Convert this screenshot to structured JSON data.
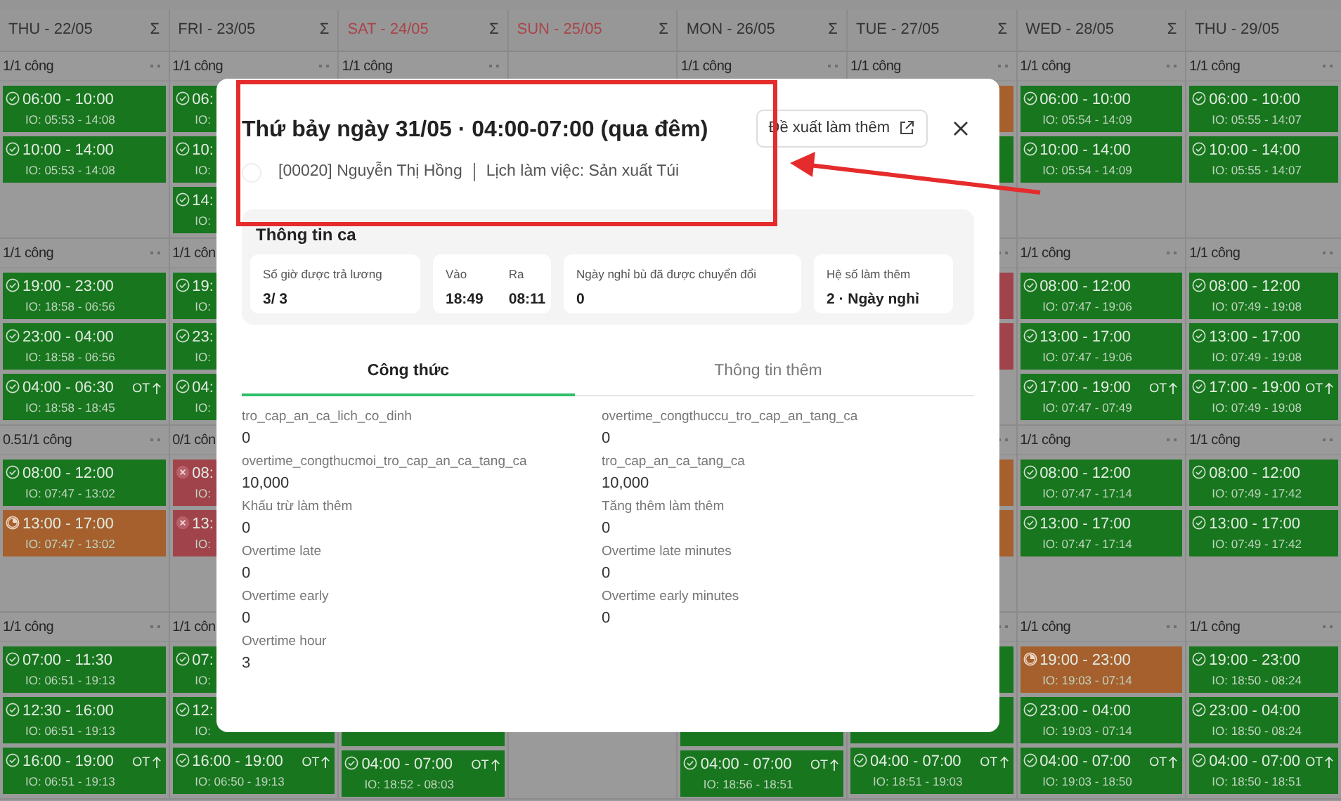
{
  "calendar": {
    "columns": [
      {
        "day": "THU - 22/05",
        "sigma": "Σ",
        "weekend": false,
        "weeks": [
          {
            "summary": {
              "text": "1/1 công",
              "dots": true
            },
            "shifts": [
              {
                "kind": "ok",
                "time": "06:00 - 10:00",
                "io": "IO: 05:53 - 14:08"
              },
              {
                "kind": "ok",
                "time": "10:00 - 14:00",
                "io": "IO: 05:53 - 14:08"
              }
            ]
          },
          {
            "summary": {
              "text": "1/1 công",
              "dots": true
            },
            "shifts": [
              {
                "kind": "ok",
                "time": "19:00 - 23:00",
                "io": "IO: 18:58 - 06:56"
              },
              {
                "kind": "ok",
                "time": "23:00 - 04:00",
                "io": "IO: 18:58 - 06:56"
              },
              {
                "kind": "ok",
                "time": "04:00 - 06:30",
                "ot": "OT",
                "io": "IO: 18:58 - 18:45"
              }
            ]
          },
          {
            "summary": {
              "text": "0.51/1 công",
              "dots": true
            },
            "shifts": [
              {
                "kind": "ok",
                "time": "08:00 - 12:00",
                "io": "IO: 07:47 - 13:02"
              },
              {
                "kind": "partial",
                "time": "13:00 - 17:00",
                "io": "IO: 07:47 - 13:02"
              }
            ]
          },
          {
            "summary": {
              "text": "1/1 công",
              "dots": true
            },
            "shifts": [
              {
                "kind": "ok",
                "time": "07:00 - 11:30",
                "io": "IO: 06:51 - 19:13"
              },
              {
                "kind": "ok",
                "time": "12:30 - 16:00",
                "io": "IO: 06:51 - 19:13"
              },
              {
                "kind": "ok",
                "time": "16:00 - 19:00",
                "ot": "OT",
                "io": "IO: 06:51 - 19:13"
              }
            ]
          }
        ]
      },
      {
        "day": "FRI - 23/05",
        "sigma": "Σ",
        "weekend": false,
        "weeks": [
          {
            "summary": {
              "text": "1/1 công",
              "dots": true
            },
            "shifts": [
              {
                "kind": "ok",
                "time": "06:",
                "io": "IO:"
              },
              {
                "kind": "ok",
                "time": "10:",
                "io": "IO:"
              },
              {
                "kind": "ok",
                "time": "14:",
                "io": "IO:"
              }
            ]
          },
          {
            "summary": {
              "text": "1/1 côn",
              "dots": false
            },
            "shifts": [
              {
                "kind": "ok",
                "time": "19:",
                "io": "IO:"
              },
              {
                "kind": "ok",
                "time": "23:",
                "io": "IO:"
              },
              {
                "kind": "ok",
                "time": "04:",
                "io": "IO:"
              }
            ]
          },
          {
            "summary": {
              "text": "0/1 côn",
              "dots": false
            },
            "shifts": [
              {
                "kind": "absent",
                "time": "08:",
                "io": "IO:"
              },
              {
                "kind": "absent",
                "time": "13:",
                "io": "IO:"
              }
            ]
          },
          {
            "summary": {
              "text": "1/1 côn",
              "dots": false
            },
            "shifts": [
              {
                "kind": "ok",
                "time": "07:",
                "io": "IO:"
              },
              {
                "kind": "ok",
                "time": "12:",
                "io": "IO:"
              },
              {
                "kind": "ok",
                "time": "16:00 - 19:00",
                "ot": "OT",
                "io": "IO: 06:50 - 19:13"
              }
            ]
          }
        ]
      },
      {
        "day": "SAT - 24/05",
        "sigma": "Σ",
        "weekend": true,
        "weeks": [
          {
            "summary": {
              "text": "1/1 công",
              "dots": true
            }
          }
        ],
        "last_week": {
          "shifts": [
            {
              "kind": "ok"
            },
            {
              "kind": "ok",
              "time": "04:00 - 07:00",
              "ot": "OT",
              "io": "IO: 18:52 - 08:03"
            }
          ]
        }
      },
      {
        "day": "SUN - 25/05",
        "sigma": "Σ",
        "weekend": true
      },
      {
        "day": "MON - 26/05",
        "sigma": "Σ",
        "weekend": false,
        "weeks": [
          {
            "summary": {
              "text": "1/1 công",
              "dots": true
            }
          }
        ],
        "last_week": {
          "shifts": [
            {
              "kind": "ok"
            },
            {
              "kind": "ok",
              "time": "04:00 - 07:00",
              "ot": "OT",
              "io": "IO: 18:56 - 18:51"
            }
          ]
        }
      },
      {
        "day": "TUE - 27/05",
        "sigma": "Σ",
        "weekend": false,
        "weeks": [
          {
            "summary": {
              "text": "1/1 công",
              "dots": true
            },
            "shifts": [
              {
                "kind": "partial"
              },
              {
                "kind": "ok"
              }
            ]
          },
          {
            "summary": {
              "dots": true
            },
            "shifts": [
              {
                "kind": "absent"
              },
              {
                "kind": "absent"
              }
            ]
          },
          {
            "summary": {
              "dots": true
            },
            "shifts": [
              {
                "kind": "partial"
              },
              {
                "kind": "partial"
              }
            ]
          },
          {
            "summary": {
              "dots": true
            },
            "shifts": [
              {
                "kind": "ok"
              },
              {
                "kind": "ok"
              },
              {
                "kind": "ok",
                "time": "04:00 - 07:00",
                "ot": "OT",
                "io": "IO: 18:51 - 19:03"
              }
            ]
          }
        ]
      },
      {
        "day": "WED - 28/05",
        "sigma": "Σ",
        "weekend": false,
        "weeks": [
          {
            "summary": {
              "text": "1/1 công",
              "dots": true
            },
            "shifts": [
              {
                "kind": "ok",
                "time": "06:00 - 10:00",
                "io": "IO: 05:54 - 14:09"
              },
              {
                "kind": "ok",
                "time": "10:00 - 14:00",
                "io": "IO: 05:54 - 14:09"
              }
            ]
          },
          {
            "summary": {
              "text": "1/1 công",
              "dots": true
            },
            "shifts": [
              {
                "kind": "ok",
                "time": "08:00 - 12:00",
                "io": "IO: 07:47 - 19:06"
              },
              {
                "kind": "ok",
                "time": "13:00 - 17:00",
                "io": "IO: 07:47 - 19:06"
              },
              {
                "kind": "ok",
                "time": "17:00 - 19:00",
                "ot": "OT",
                "io": "IO: 07:47 - 07:49"
              }
            ]
          },
          {
            "summary": {
              "text": "1/1 công",
              "dots": true
            },
            "shifts": [
              {
                "kind": "ok",
                "time": "08:00 - 12:00",
                "io": "IO: 07:47 - 17:14"
              },
              {
                "kind": "ok",
                "time": "13:00 - 17:00",
                "io": "IO: 07:47 - 17:14"
              }
            ]
          },
          {
            "summary": {
              "text": "1/1 công",
              "dots": true
            },
            "shifts": [
              {
                "kind": "partial",
                "time": "19:00 - 23:00",
                "io": "IO: 19:03 - 07:14"
              },
              {
                "kind": "ok",
                "time": "23:00 - 04:00",
                "io": "IO: 19:03 - 07:14"
              },
              {
                "kind": "ok",
                "time": "04:00 - 07:00",
                "ot": "OT",
                "io": "IO: 19:03 - 18:50"
              }
            ]
          }
        ]
      },
      {
        "day": "THU - 29/05",
        "weekend": false,
        "weeks": [
          {
            "summary": {
              "text": "1/1 công",
              "dots": true
            },
            "shifts": [
              {
                "kind": "ok",
                "time": "06:00 - 10:00",
                "io": "IO: 05:55 - 14:07"
              },
              {
                "kind": "ok",
                "time": "10:00 - 14:00",
                "io": "IO: 05:55 - 14:07"
              }
            ]
          },
          {
            "summary": {
              "text": "1/1 công",
              "dots": true
            },
            "shifts": [
              {
                "kind": "ok",
                "time": "08:00 - 12:00",
                "io": "IO: 07:49 - 19:08"
              },
              {
                "kind": "ok",
                "time": "13:00 - 17:00",
                "io": "IO: 07:49 - 19:08"
              },
              {
                "kind": "ok",
                "time": "17:00 - 19:00",
                "ot": "OT",
                "io": "IO: 07:49 - 19:08"
              }
            ]
          },
          {
            "summary": {
              "text": "1/1 công",
              "dots": true
            },
            "shifts": [
              {
                "kind": "ok",
                "time": "08:00 - 12:00",
                "io": "IO: 07:49 - 17:42"
              },
              {
                "kind": "ok",
                "time": "13:00 - 17:00",
                "io": "IO: 07:49 - 17:42"
              }
            ]
          },
          {
            "summary": {
              "text": "1/1 công",
              "dots": true
            },
            "shifts": [
              {
                "kind": "ok",
                "time": "19:00 - 23:00",
                "io": "IO: 18:50 - 08:24"
              },
              {
                "kind": "ok",
                "time": "23:00 - 04:00",
                "io": "IO: 18:50 - 08:24"
              },
              {
                "kind": "ok",
                "time": "04:00 - 07:00",
                "ot": "OT",
                "io": "IO: 18:50 - 18:51"
              }
            ]
          }
        ]
      }
    ]
  },
  "modal": {
    "title": "Thứ bảy ngày 31/05 · 04:00-07:00 (qua đêm)",
    "employee": "[00020] Nguyễn Thị Hồng",
    "schedule": "Lịch làm việc: Sản xuất Túi",
    "action_button": "Đề xuất làm thêm",
    "shift_info": {
      "title": "Thông tin ca",
      "cards": [
        {
          "kind": "single",
          "label": "Số giờ được trả lương",
          "value": "3/ 3"
        },
        {
          "kind": "pair",
          "items": [
            {
              "label": "Vào",
              "value": "18:49"
            },
            {
              "label": "Ra",
              "value": "08:11"
            }
          ]
        },
        {
          "kind": "single",
          "label": "Ngày nghỉ bù đã được chuyển đổi",
          "value": "0"
        },
        {
          "kind": "single",
          "label": "Hệ số làm thêm",
          "value": "2 · Ngày nghỉ"
        }
      ]
    },
    "tabs": [
      {
        "label": "Công thức",
        "selected": true
      },
      {
        "label": "Thông tin thêm",
        "selected": false
      }
    ],
    "fields": [
      {
        "label": "tro_cap_an_ca_lich_co_dinh",
        "value": "0"
      },
      {
        "label": "overtime_congthuccu_tro_cap_an_tang_ca",
        "value": "0"
      },
      {
        "label": "overtime_congthucmoi_tro_cap_an_ca_tang_ca",
        "value": "10,000"
      },
      {
        "label": "tro_cap_an_ca_tang_ca",
        "value": "10,000"
      },
      {
        "label": "Khấu trừ làm thêm",
        "value": "0"
      },
      {
        "label": "Tăng thêm làm thêm",
        "value": "0"
      },
      {
        "label": "Overtime late",
        "value": "0"
      },
      {
        "label": "Overtime late minutes",
        "value": "0"
      },
      {
        "label": "Overtime early",
        "value": "0"
      },
      {
        "label": "Overtime early minutes",
        "value": "0"
      },
      {
        "label": "Overtime hour",
        "value": "3"
      }
    ]
  }
}
